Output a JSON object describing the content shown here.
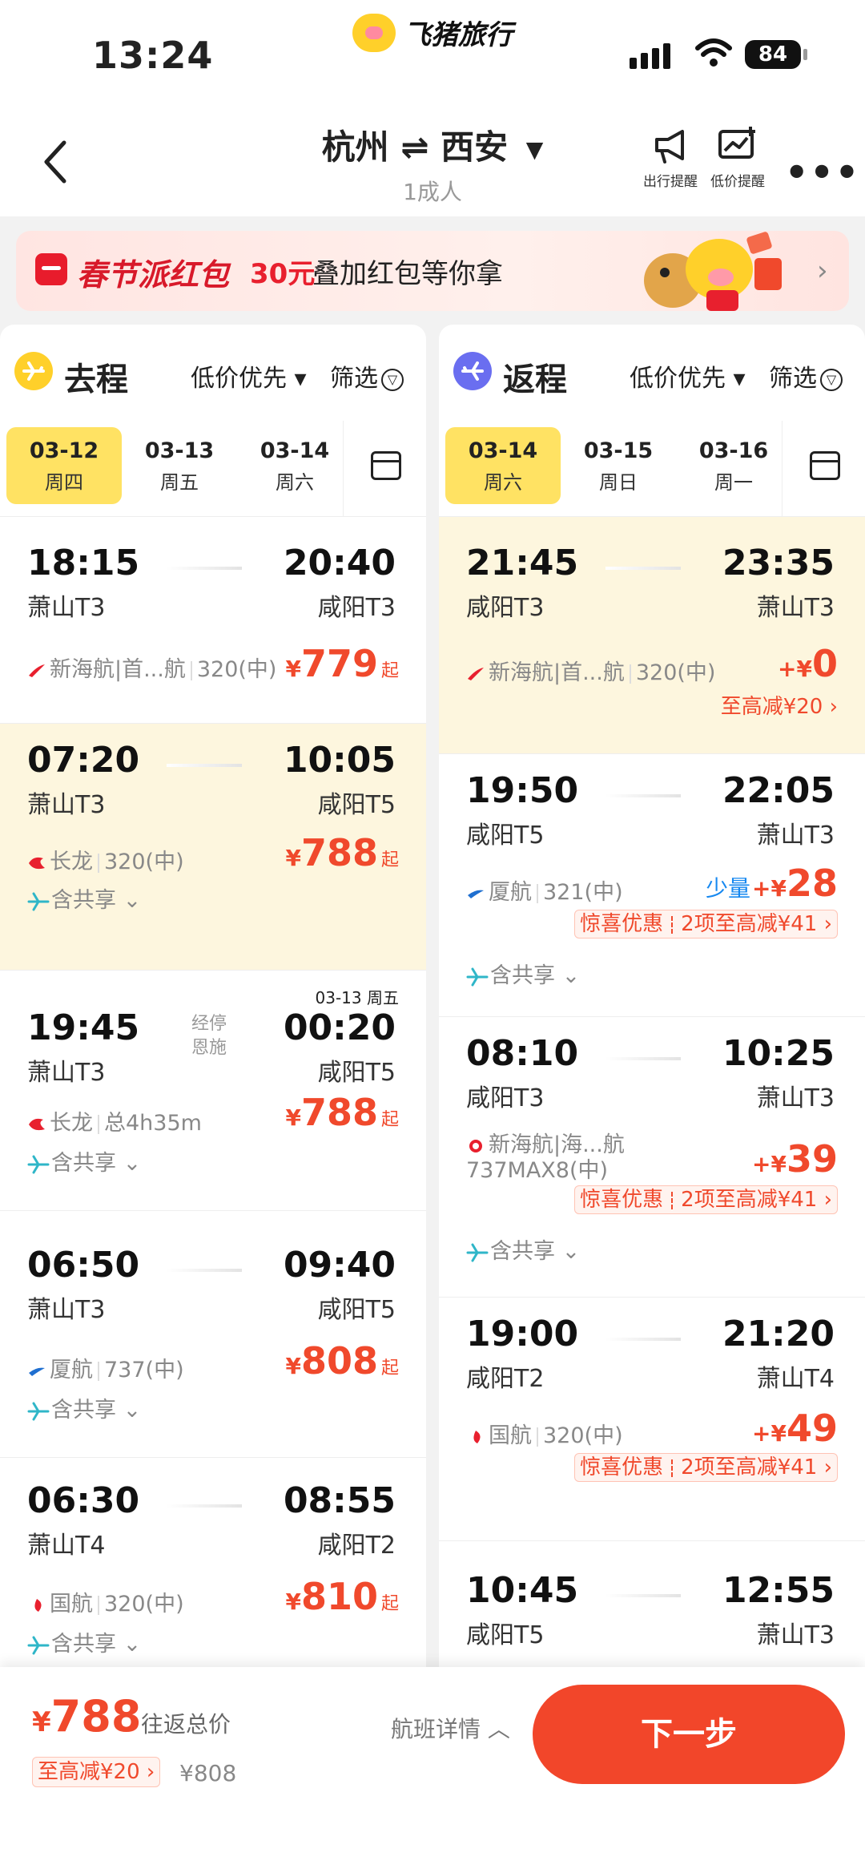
{
  "status_bar": {
    "time": "13:24",
    "brand": "飞猪旅行",
    "battery": "84"
  },
  "nav": {
    "route_from": "杭州",
    "route_swap": "⇌",
    "route_to": "西安",
    "passengers": "1成人",
    "tool1": "出行提醒",
    "tool2": "低价提醒"
  },
  "banner": {
    "title": "春节派红包",
    "amount": "30元",
    "text": "叠加红包等你拿"
  },
  "outbound": {
    "title": "去程",
    "sort": "低价优先",
    "filter": "筛选",
    "dates": [
      {
        "date": "03-12",
        "weekday": "周四"
      },
      {
        "date": "03-13",
        "weekday": "周五"
      },
      {
        "date": "03-14",
        "weekday": "周六"
      }
    ],
    "flights": [
      {
        "dep": "18:15",
        "dep_ap": "萧山T3",
        "arr": "20:40",
        "arr_ap": "咸阳T3",
        "airline": "新海航|首...航",
        "plane": "320(中)",
        "cur": "¥",
        "price": "779",
        "qi": "起"
      },
      {
        "dep": "07:20",
        "dep_ap": "萧山T3",
        "arr": "10:05",
        "arr_ap": "咸阳T5",
        "airline": "长龙",
        "plane": "320(中)",
        "cur": "¥",
        "price": "788",
        "qi": "起",
        "share": "含共享"
      },
      {
        "dep": "19:45",
        "dep_ap": "萧山T3",
        "arr": "00:20",
        "arr_ap": "咸阳T5",
        "next_day": "03-13 周五",
        "stop1": "经停",
        "stop2": "恩施",
        "airline": "长龙",
        "plane": "总4h35m",
        "cur": "¥",
        "price": "788",
        "qi": "起",
        "share": "含共享"
      },
      {
        "dep": "06:50",
        "dep_ap": "萧山T3",
        "arr": "09:40",
        "arr_ap": "咸阳T5",
        "airline": "厦航",
        "plane": "737(中)",
        "cur": "¥",
        "price": "808",
        "qi": "起",
        "share": "含共享"
      },
      {
        "dep": "06:30",
        "dep_ap": "萧山T4",
        "arr": "08:55",
        "arr_ap": "咸阳T2",
        "airline": "国航",
        "plane": "320(中)",
        "cur": "¥",
        "price": "810",
        "qi": "起",
        "share": "含共享"
      }
    ]
  },
  "return": {
    "title": "返程",
    "sort": "低价优先",
    "filter": "筛选",
    "dates": [
      {
        "date": "03-14",
        "weekday": "周六"
      },
      {
        "date": "03-15",
        "weekday": "周日"
      },
      {
        "date": "03-16",
        "weekday": "周一"
      }
    ],
    "flights": [
      {
        "dep": "21:45",
        "dep_ap": "咸阳T3",
        "arr": "23:35",
        "arr_ap": "萧山T3",
        "airline": "新海航|首...航",
        "plane": "320(中)",
        "cur": "+¥",
        "price": "0",
        "disc": "至高减¥20"
      },
      {
        "dep": "19:50",
        "dep_ap": "咸阳T5",
        "arr": "22:05",
        "arr_ap": "萧山T3",
        "airline": "厦航",
        "plane": "321(中)",
        "few": "少量",
        "cur": "+¥",
        "price": "28",
        "promo1": "惊喜优惠",
        "promo2": "2项至高减¥41",
        "share": "含共享"
      },
      {
        "dep": "08:10",
        "dep_ap": "咸阳T3",
        "arr": "10:25",
        "arr_ap": "萧山T3",
        "airline": "新海航|海...航",
        "plane": "737MAX8(中)",
        "cur": "+¥",
        "price": "39",
        "promo1": "惊喜优惠",
        "promo2": "2项至高减¥41",
        "share": "含共享"
      },
      {
        "dep": "19:00",
        "dep_ap": "咸阳T2",
        "arr": "21:20",
        "arr_ap": "萧山T4",
        "airline": "国航",
        "plane": "320(中)",
        "cur": "+¥",
        "price": "49",
        "promo1": "惊喜优惠",
        "promo2": "2项至高减¥41"
      },
      {
        "dep": "10:45",
        "dep_ap": "咸阳T5",
        "arr": "12:55",
        "arr_ap": "萧山T3"
      }
    ]
  },
  "bottom": {
    "cur": "¥",
    "total": "788",
    "total_label": "往返总价",
    "discount": "至高减¥20",
    "original": "¥808",
    "details": "航班详情",
    "next": "下一步"
  },
  "colors": {
    "accent": "#f2462a",
    "price": "#f0492c",
    "selected_date": "#ffe263",
    "selected_row": "#fdf6de",
    "outbound_icon": "#ffd02a",
    "return_icon": "#6a6ef0"
  }
}
